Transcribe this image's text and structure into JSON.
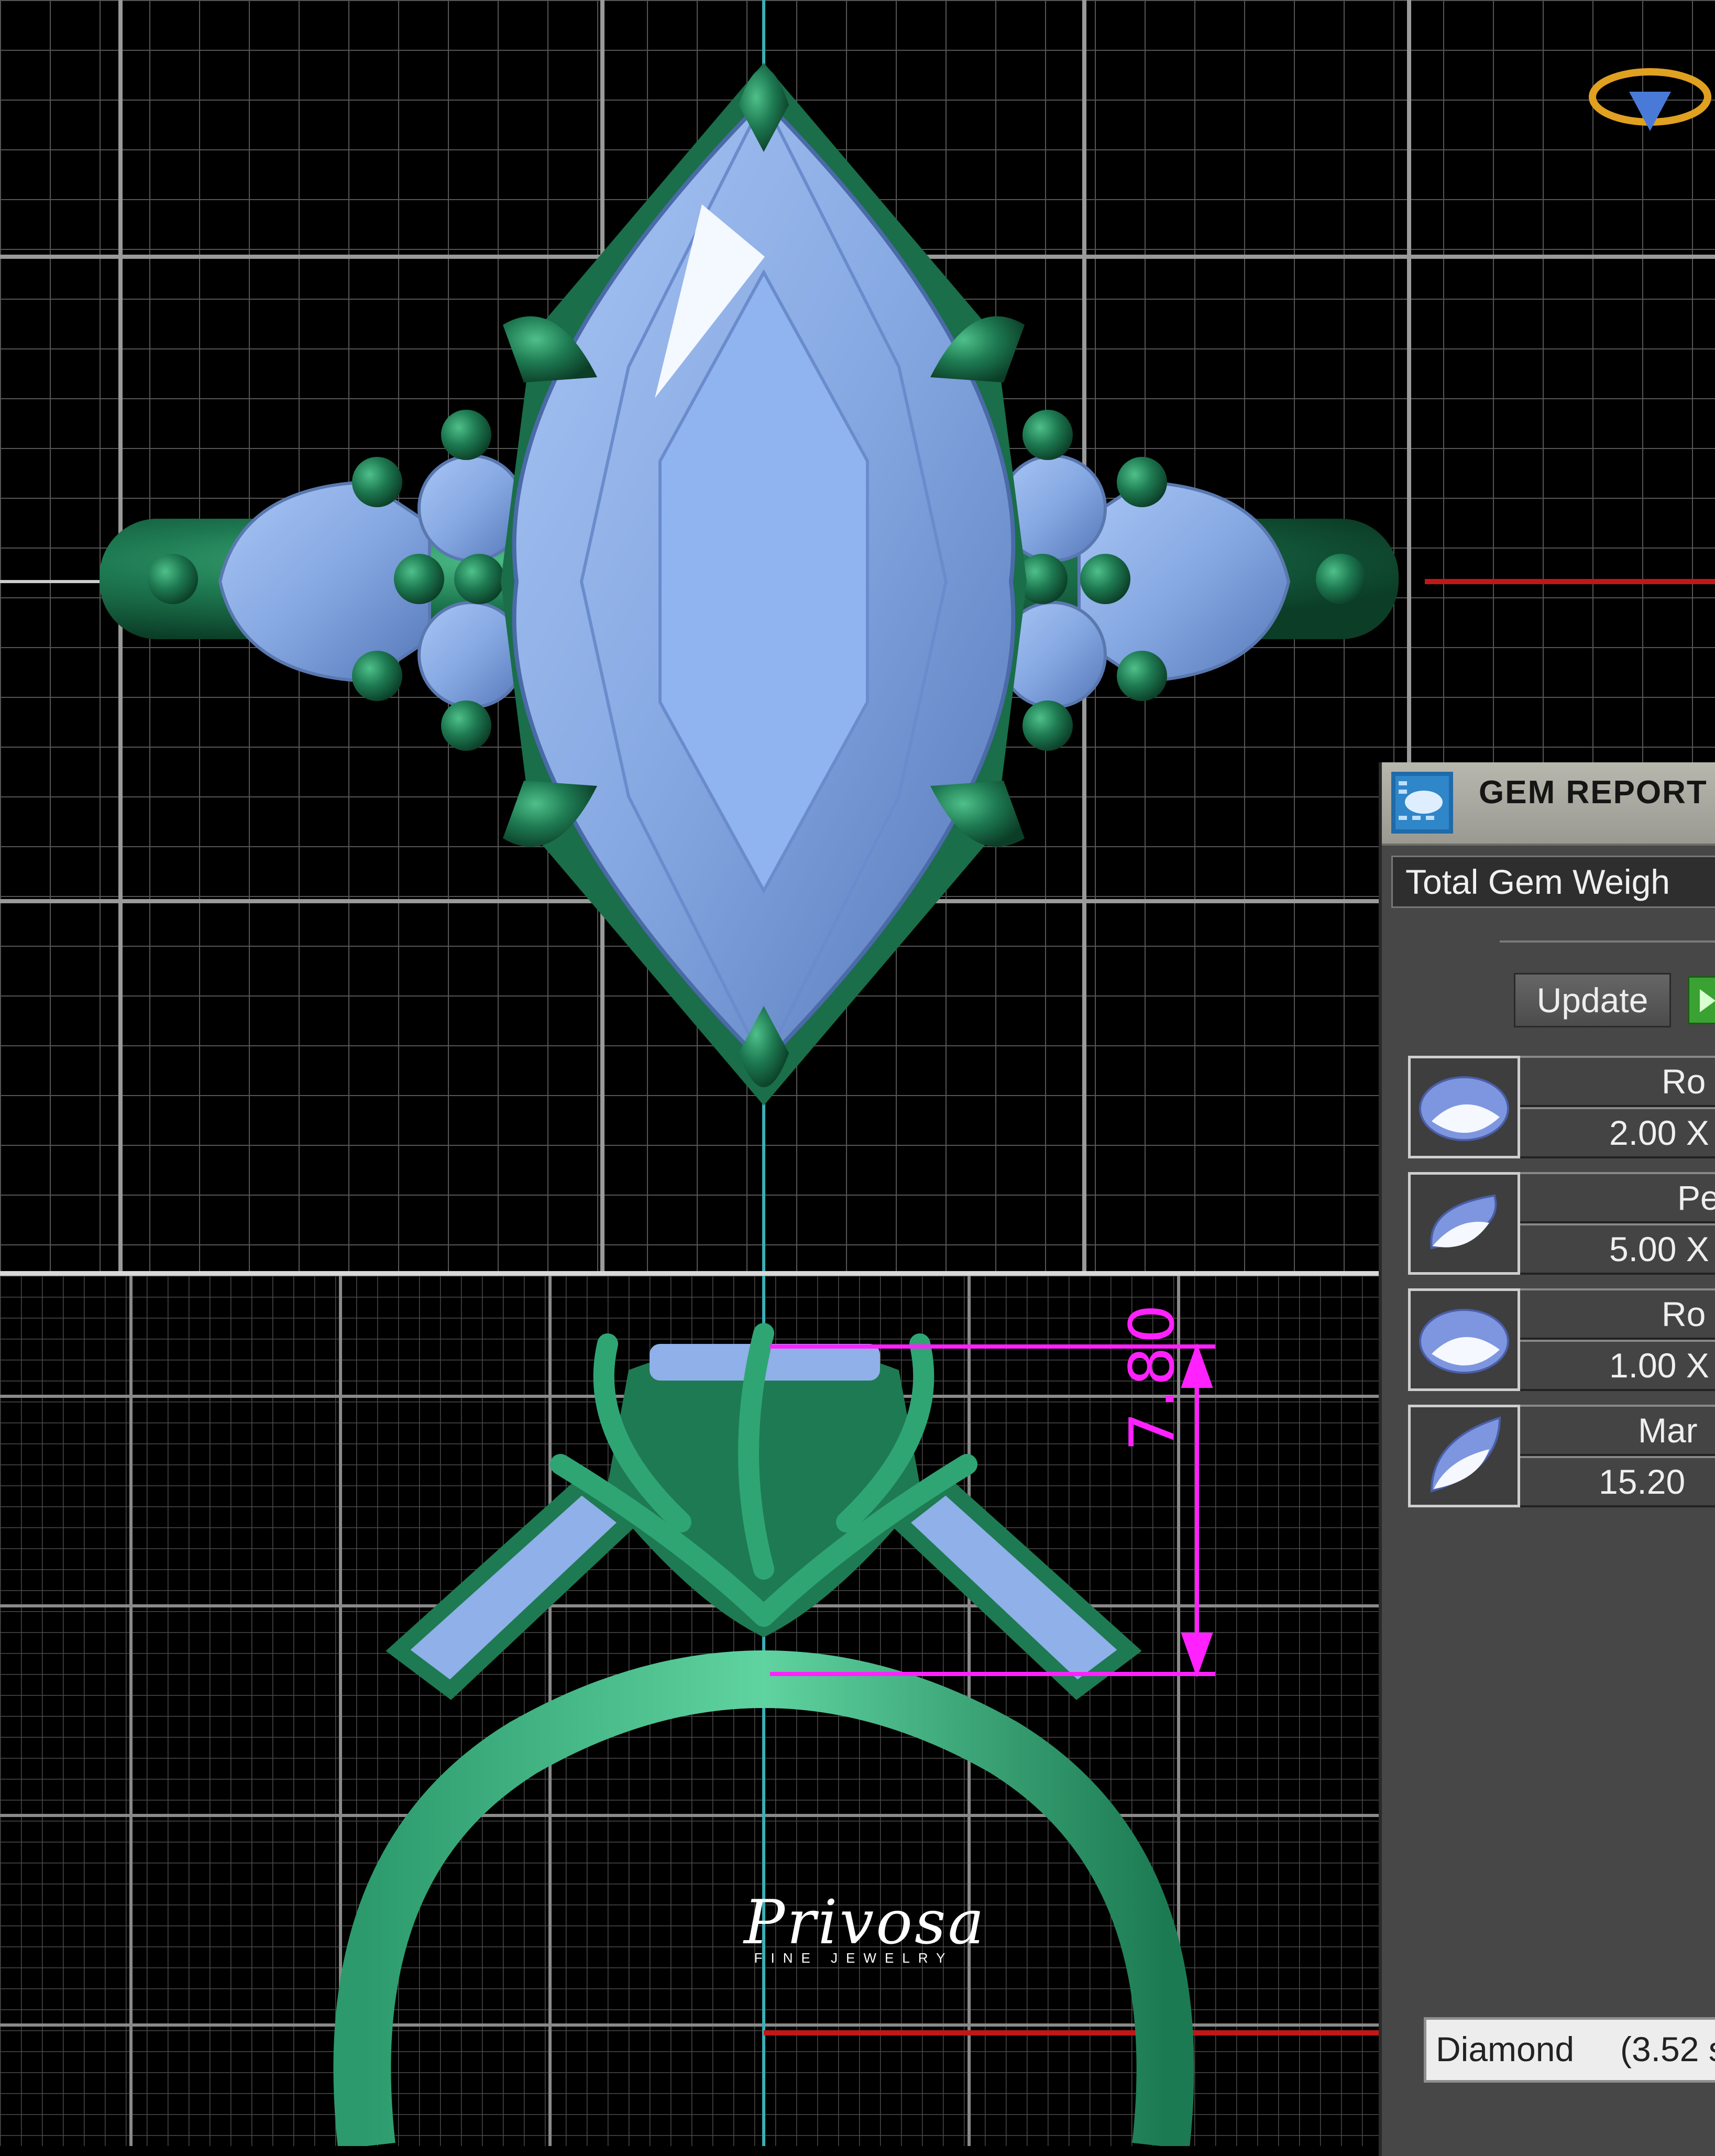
{
  "gem_report": {
    "title": "GEM REPORT",
    "total_gem_weight_label": "Total Gem Weigh",
    "update_button_label": "Update",
    "gems": [
      {
        "name": "Ro",
        "size": "2.00 X",
        "shape_icon": "round-gem-icon"
      },
      {
        "name": "Pe",
        "size": "5.00 X",
        "shape_icon": "pear-gem-icon"
      },
      {
        "name": "Ro",
        "size": "1.00 X",
        "shape_icon": "round-gem-icon"
      },
      {
        "name": "Mar",
        "size": "15.20",
        "shape_icon": "marquise-gem-icon"
      }
    ],
    "footer": {
      "material": "Diamond",
      "weight": "(3.52 s"
    }
  },
  "dimension": {
    "value": "7.80"
  },
  "watermark": {
    "brand": "Privosa",
    "tagline": "FINE JEWELRY"
  },
  "colors": {
    "metal": "#1e7a52",
    "gem": "#8fb0e8",
    "grid": "#707070",
    "axis_vertical": "#3ab0b8",
    "axis_horizontal": "#c01818",
    "dimension": "#ff22ff",
    "play_button": "#3aa232"
  }
}
